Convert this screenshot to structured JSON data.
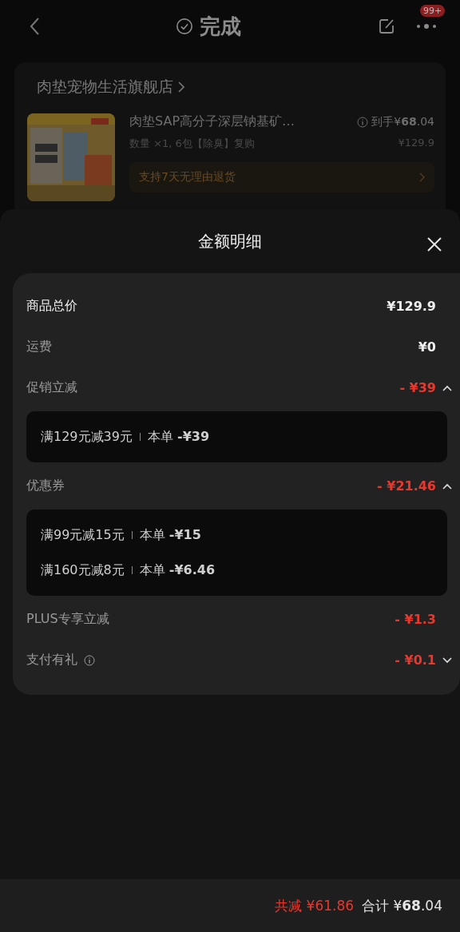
{
  "nav": {
    "title": "完成",
    "badge": "99+"
  },
  "order": {
    "store": "肉垫宠物生活旗舰店",
    "product": {
      "name": "肉垫SAP高分子深层钠基矿…",
      "price": "到手¥**68**.04",
      "spec": "数量 ×1, 6包【除臭】复购",
      "original_price": "¥129.9",
      "return_policy": "支持7天无理由退货"
    }
  },
  "sheet": {
    "title": "金额明细",
    "rows": [
      {
        "kind": "total",
        "label": "商品总价",
        "amount": "¥129.9"
      },
      {
        "kind": "fee",
        "label": "运费",
        "amount": "¥0"
      },
      {
        "kind": "discount",
        "label": "促销立减",
        "amount": "- ¥39",
        "expanded": true,
        "details": [
          {
            "condition": "满129元减39元",
            "deduction": "本单 **-¥39**"
          }
        ]
      },
      {
        "kind": "discount",
        "label": "优惠券",
        "amount": "- ¥21.46",
        "expanded": true,
        "details": [
          {
            "condition": "满99元减15元",
            "deduction": "本单 **-¥15**"
          },
          {
            "condition": "满160元减8元",
            "deduction": "本单 **-¥6.46**"
          }
        ]
      },
      {
        "kind": "discount",
        "label": "PLUS专享立减",
        "amount": "- ¥1.3"
      },
      {
        "kind": "discount",
        "label": "支付有礼",
        "amount": "- ¥0.1",
        "info": true,
        "expanded": false
      }
    ]
  },
  "footer": {
    "saved": "共减 ¥61.86",
    "total": "合计 ¥**68**.04"
  }
}
